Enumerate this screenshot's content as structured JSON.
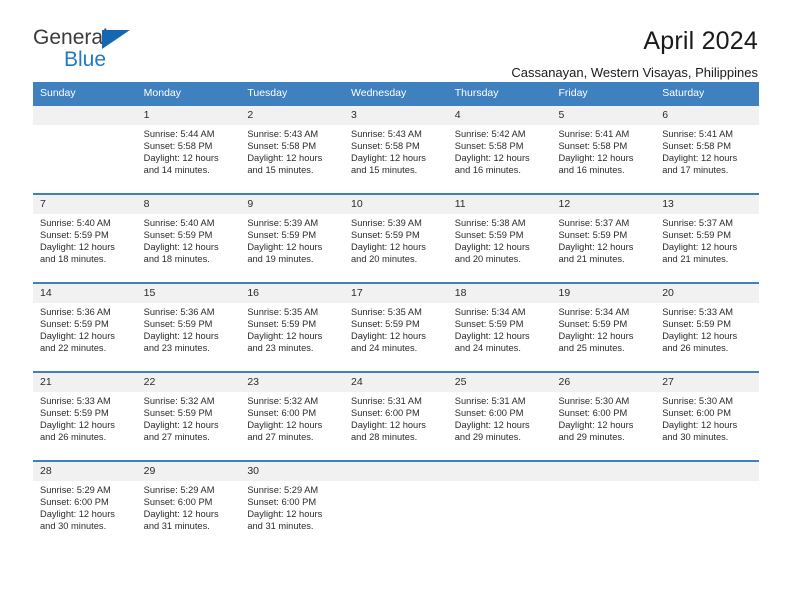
{
  "brand": {
    "word_one": "General",
    "word_two": "Blue",
    "triangle_icon": "triangle-icon",
    "accent_color": "#1567b2",
    "blue_text_color": "#1f7ac4"
  },
  "header": {
    "title": "April 2024",
    "subtitle": "Cassanayan, Western Visayas, Philippines"
  },
  "calendar": {
    "header_bg": "#3f81bf",
    "header_text_color": "#ffffff",
    "daynum_bg": "#f1f1f1",
    "weekdays": [
      "Sunday",
      "Monday",
      "Tuesday",
      "Wednesday",
      "Thursday",
      "Friday",
      "Saturday"
    ],
    "weeks": [
      [
        {
          "day": "",
          "lines": ""
        },
        {
          "day": "1",
          "lines": "Sunrise: 5:44 AM\nSunset: 5:58 PM\nDaylight: 12 hours\nand 14 minutes."
        },
        {
          "day": "2",
          "lines": "Sunrise: 5:43 AM\nSunset: 5:58 PM\nDaylight: 12 hours\nand 15 minutes."
        },
        {
          "day": "3",
          "lines": "Sunrise: 5:43 AM\nSunset: 5:58 PM\nDaylight: 12 hours\nand 15 minutes."
        },
        {
          "day": "4",
          "lines": "Sunrise: 5:42 AM\nSunset: 5:58 PM\nDaylight: 12 hours\nand 16 minutes."
        },
        {
          "day": "5",
          "lines": "Sunrise: 5:41 AM\nSunset: 5:58 PM\nDaylight: 12 hours\nand 16 minutes."
        },
        {
          "day": "6",
          "lines": "Sunrise: 5:41 AM\nSunset: 5:58 PM\nDaylight: 12 hours\nand 17 minutes."
        }
      ],
      [
        {
          "day": "7",
          "lines": "Sunrise: 5:40 AM\nSunset: 5:59 PM\nDaylight: 12 hours\nand 18 minutes."
        },
        {
          "day": "8",
          "lines": "Sunrise: 5:40 AM\nSunset: 5:59 PM\nDaylight: 12 hours\nand 18 minutes."
        },
        {
          "day": "9",
          "lines": "Sunrise: 5:39 AM\nSunset: 5:59 PM\nDaylight: 12 hours\nand 19 minutes."
        },
        {
          "day": "10",
          "lines": "Sunrise: 5:39 AM\nSunset: 5:59 PM\nDaylight: 12 hours\nand 20 minutes."
        },
        {
          "day": "11",
          "lines": "Sunrise: 5:38 AM\nSunset: 5:59 PM\nDaylight: 12 hours\nand 20 minutes."
        },
        {
          "day": "12",
          "lines": "Sunrise: 5:37 AM\nSunset: 5:59 PM\nDaylight: 12 hours\nand 21 minutes."
        },
        {
          "day": "13",
          "lines": "Sunrise: 5:37 AM\nSunset: 5:59 PM\nDaylight: 12 hours\nand 21 minutes."
        }
      ],
      [
        {
          "day": "14",
          "lines": "Sunrise: 5:36 AM\nSunset: 5:59 PM\nDaylight: 12 hours\nand 22 minutes."
        },
        {
          "day": "15",
          "lines": "Sunrise: 5:36 AM\nSunset: 5:59 PM\nDaylight: 12 hours\nand 23 minutes."
        },
        {
          "day": "16",
          "lines": "Sunrise: 5:35 AM\nSunset: 5:59 PM\nDaylight: 12 hours\nand 23 minutes."
        },
        {
          "day": "17",
          "lines": "Sunrise: 5:35 AM\nSunset: 5:59 PM\nDaylight: 12 hours\nand 24 minutes."
        },
        {
          "day": "18",
          "lines": "Sunrise: 5:34 AM\nSunset: 5:59 PM\nDaylight: 12 hours\nand 24 minutes."
        },
        {
          "day": "19",
          "lines": "Sunrise: 5:34 AM\nSunset: 5:59 PM\nDaylight: 12 hours\nand 25 minutes."
        },
        {
          "day": "20",
          "lines": "Sunrise: 5:33 AM\nSunset: 5:59 PM\nDaylight: 12 hours\nand 26 minutes."
        }
      ],
      [
        {
          "day": "21",
          "lines": "Sunrise: 5:33 AM\nSunset: 5:59 PM\nDaylight: 12 hours\nand 26 minutes."
        },
        {
          "day": "22",
          "lines": "Sunrise: 5:32 AM\nSunset: 5:59 PM\nDaylight: 12 hours\nand 27 minutes."
        },
        {
          "day": "23",
          "lines": "Sunrise: 5:32 AM\nSunset: 6:00 PM\nDaylight: 12 hours\nand 27 minutes."
        },
        {
          "day": "24",
          "lines": "Sunrise: 5:31 AM\nSunset: 6:00 PM\nDaylight: 12 hours\nand 28 minutes."
        },
        {
          "day": "25",
          "lines": "Sunrise: 5:31 AM\nSunset: 6:00 PM\nDaylight: 12 hours\nand 29 minutes."
        },
        {
          "day": "26",
          "lines": "Sunrise: 5:30 AM\nSunset: 6:00 PM\nDaylight: 12 hours\nand 29 minutes."
        },
        {
          "day": "27",
          "lines": "Sunrise: 5:30 AM\nSunset: 6:00 PM\nDaylight: 12 hours\nand 30 minutes."
        }
      ],
      [
        {
          "day": "28",
          "lines": "Sunrise: 5:29 AM\nSunset: 6:00 PM\nDaylight: 12 hours\nand 30 minutes."
        },
        {
          "day": "29",
          "lines": "Sunrise: 5:29 AM\nSunset: 6:00 PM\nDaylight: 12 hours\nand 31 minutes."
        },
        {
          "day": "30",
          "lines": "Sunrise: 5:29 AM\nSunset: 6:00 PM\nDaylight: 12 hours\nand 31 minutes."
        },
        {
          "day": "",
          "lines": ""
        },
        {
          "day": "",
          "lines": ""
        },
        {
          "day": "",
          "lines": ""
        },
        {
          "day": "",
          "lines": ""
        }
      ]
    ]
  }
}
